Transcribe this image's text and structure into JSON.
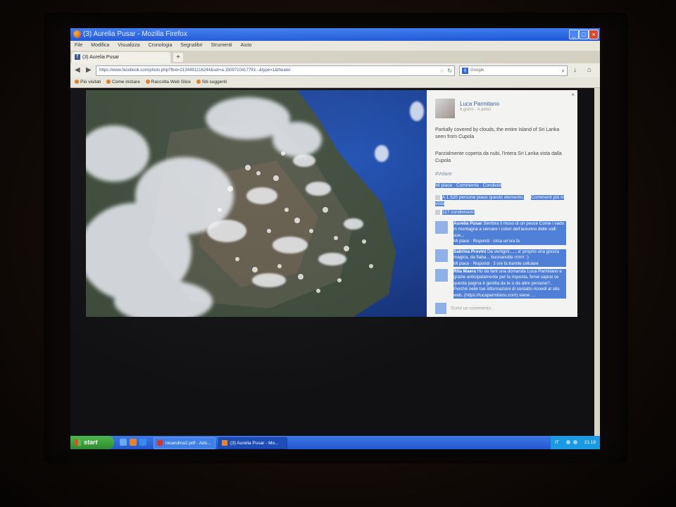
{
  "window": {
    "title": "(3) Aurelia Pusar - Mozilla Firefox",
    "controls": [
      "_",
      "□",
      "×"
    ]
  },
  "menu": [
    "File",
    "Modifica",
    "Visualizza",
    "Cronologia",
    "Segnalibri",
    "Strumenti",
    "Aiuto"
  ],
  "tabs": [
    {
      "label": "(3) Aurelia Pusar"
    }
  ],
  "newtab_label": "+",
  "nav": {
    "url": "https://www.facebook.com/photo.php?fbid=2134491216244&set=a.1509710417793...&type=1&theater",
    "search_engine": "Google"
  },
  "bookmarks": [
    "Più visitati",
    "Come iniziare",
    "Raccolta Web Slice",
    "Siti suggeriti"
  ],
  "post": {
    "author": "Luca Parmitano",
    "meta": "6 giorni · A amici",
    "caption_en": "Partially covered by clouds, the entire Island of Sri Lanka seen from Cupola",
    "caption_it": "Parzialmente coperta da nubi, l'intera Sri Lanka vista dalla Cupola",
    "hashtag": "#Volare",
    "actions": "Mi piace · Commenta · Condividi",
    "likes": "A 1.520 persone piace questo elemento.",
    "more_comments": "Commenti più in vista",
    "shares": "117 condivisioni",
    "comments": [
      {
        "name": "Aurelia Pusar",
        "text": "Sembra il muso di un pesce Come i vado in montagna a cercare i colori dell'autunno delle valli sue...",
        "links": "Mi piace · Rispondi · circa un'ora fa"
      },
      {
        "name": "Sabrina Provini",
        "text": "Da vertigini.......e' proprio una goccia magica, da fiaba... buonanotte rrrrrrr :)",
        "links": "Mi piace · Rispondi · 3 ore fa tramite cellulare"
      },
      {
        "name": "Rita Maera",
        "text": "Ho da farti una domanda Luca Parmitano e grazie anticipatamente per la risposta, forse saprai se questa pagina è gestita da te o da altre persone?.. Perchè nelle tue informazioni di contatto ricondi al sito web, (https://lucaparmitano.com) viene ....",
        "links": ""
      }
    ],
    "write_comment": "Scrivi un commento..."
  },
  "taskbar": {
    "start": "start",
    "tasks": [
      {
        "label": "locandina2.pdf - Ado...",
        "icon_color": "#d8352a"
      },
      {
        "label": "(3) Aurelia Pusar - Mo...",
        "icon_color": "#e8832a"
      }
    ],
    "lang": "IT",
    "clock": "21:19"
  },
  "colors": {
    "titlebar": "#2459d8",
    "taskbar": "#2458cf",
    "start": "#35a035",
    "facebook": "#3b5998",
    "selection": "#4f7fd6"
  }
}
